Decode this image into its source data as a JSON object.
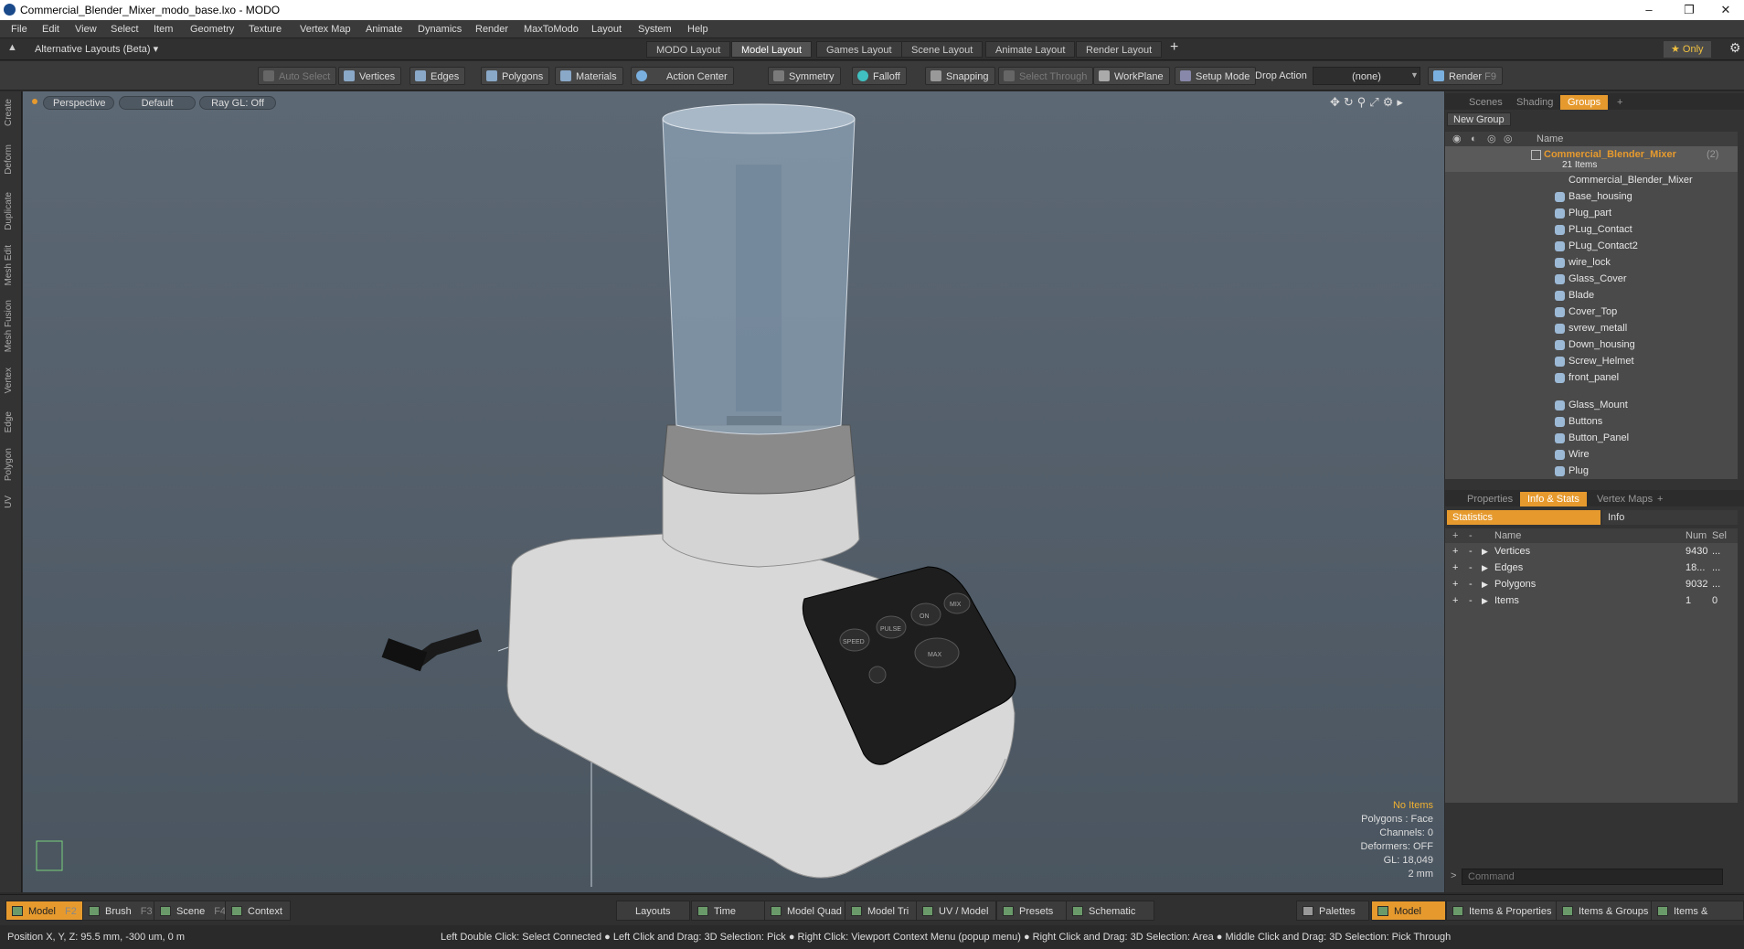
{
  "window": {
    "title": "Commercial_Blender_Mixer_modo_base.lxo - MODO",
    "minimize": "–",
    "restore": "❐",
    "close": "✕"
  },
  "menu": [
    "File",
    "Edit",
    "View",
    "Select",
    "Item",
    "Geometry",
    "Texture",
    "Vertex Map",
    "Animate",
    "Dynamics",
    "Render",
    "MaxToModo",
    "Layout",
    "System",
    "Help"
  ],
  "layoutbar": {
    "alt_layouts": "Alternative Layouts (Beta) ▾",
    "tabs": [
      "MODO Layout",
      "Model Layout",
      "Games Layout",
      "Scene Layout",
      "Animate Layout",
      "Render Layout"
    ],
    "active_tab": "Model Layout",
    "add": "+",
    "only": "★  Only"
  },
  "toolbar": {
    "auto_select": "Auto Select",
    "vertices": "Vertices",
    "edges": "Edges",
    "polygons": "Polygons",
    "materials": "Materials",
    "action_center": "Action Center",
    "symmetry": "Symmetry",
    "falloff": "Falloff",
    "snapping": "Snapping",
    "select_through": "Select Through",
    "workplane": "WorkPlane",
    "setup_mode": "Setup Mode",
    "drop_action_label": "Drop Action",
    "drop_action_value": "(none)",
    "render": "Render",
    "render_key": "F9"
  },
  "left_tabs": [
    "Create",
    "Deform",
    "Duplicate",
    "Mesh Edit",
    "Mesh Fusion",
    "Vertex",
    "Edge",
    "Polygon",
    "UV"
  ],
  "viewport": {
    "view": "Perspective",
    "shading": "Default",
    "raygl": "Ray GL: Off",
    "info": {
      "no_items": "No Items",
      "polygons": "Polygons : Face",
      "channels": "Channels: 0",
      "deformers": "Deformers: OFF",
      "gl": "GL: 18,049",
      "scale": "2 mm"
    },
    "buttons": [
      "SPEED",
      "PULSE",
      "ON",
      "MIX",
      "MAX"
    ]
  },
  "groups_panel": {
    "tabs": [
      "Scenes",
      "Shading",
      "Groups"
    ],
    "active_tab": "Groups",
    "add": "+",
    "new_group": "New Group",
    "name_col": "Name",
    "group_name": "Commercial_Blender_Mixer",
    "group_count": "(2)",
    "group_items": "21 Items",
    "items": [
      "Commercial_Blender_Mixer",
      "Base_housing",
      "Plug_part",
      "PLug_Contact",
      "PLug_Contact2",
      "wire_lock",
      "Glass_Cover",
      "Blade",
      "Cover_Top",
      "svrew_metall",
      "Down_housing",
      "Screw_Helmet",
      "front_panel",
      "Glass_Mount",
      "Buttons",
      "Button_Panel",
      "Wire",
      "Plug"
    ]
  },
  "props_panel": {
    "tabs": [
      "Properties",
      "Info & Stats",
      "Vertex Maps"
    ],
    "active_tab": "Info & Stats",
    "add": "+",
    "sub_tabs": [
      "Statistics",
      "Info"
    ],
    "cols": {
      "name": "Name",
      "num": "Num",
      "sel": "Sel"
    },
    "rows": [
      {
        "name": "Vertices",
        "num": "9430",
        "sel": "..."
      },
      {
        "name": "Edges",
        "num": "18...",
        "sel": "..."
      },
      {
        "name": "Polygons",
        "num": "9032",
        "sel": "..."
      },
      {
        "name": "Items",
        "num": "1",
        "sel": "0"
      }
    ],
    "command_placeholder": "Command"
  },
  "bottombar": {
    "model": "Model",
    "model_key": "F2",
    "brush": "Brush",
    "brush_key": "F3",
    "scene": "Scene",
    "scene_key": "F4",
    "context": "Context",
    "layouts": "Layouts",
    "time": "Time",
    "model_quad": "Model Quad",
    "model_tri": "Model Tri",
    "uv_model": "UV / Model",
    "presets": "Presets",
    "schematic": "Schematic",
    "palettes": "Palettes",
    "model_right": "Model",
    "items_props": "Items & Properties",
    "items_groups": "Items & Groups",
    "items_shading": "Items & Shading"
  },
  "status": {
    "position": "Position X, Y, Z:  95.5 mm, -300 um, 0 m",
    "hints": "Left Double Click: Select Connected ● Left Click and Drag: 3D Selection: Pick ● Right Click: Viewport Context Menu (popup menu) ● Right Click and Drag: 3D Selection: Area ● Middle Click and Drag: 3D Selection: Pick Through"
  }
}
